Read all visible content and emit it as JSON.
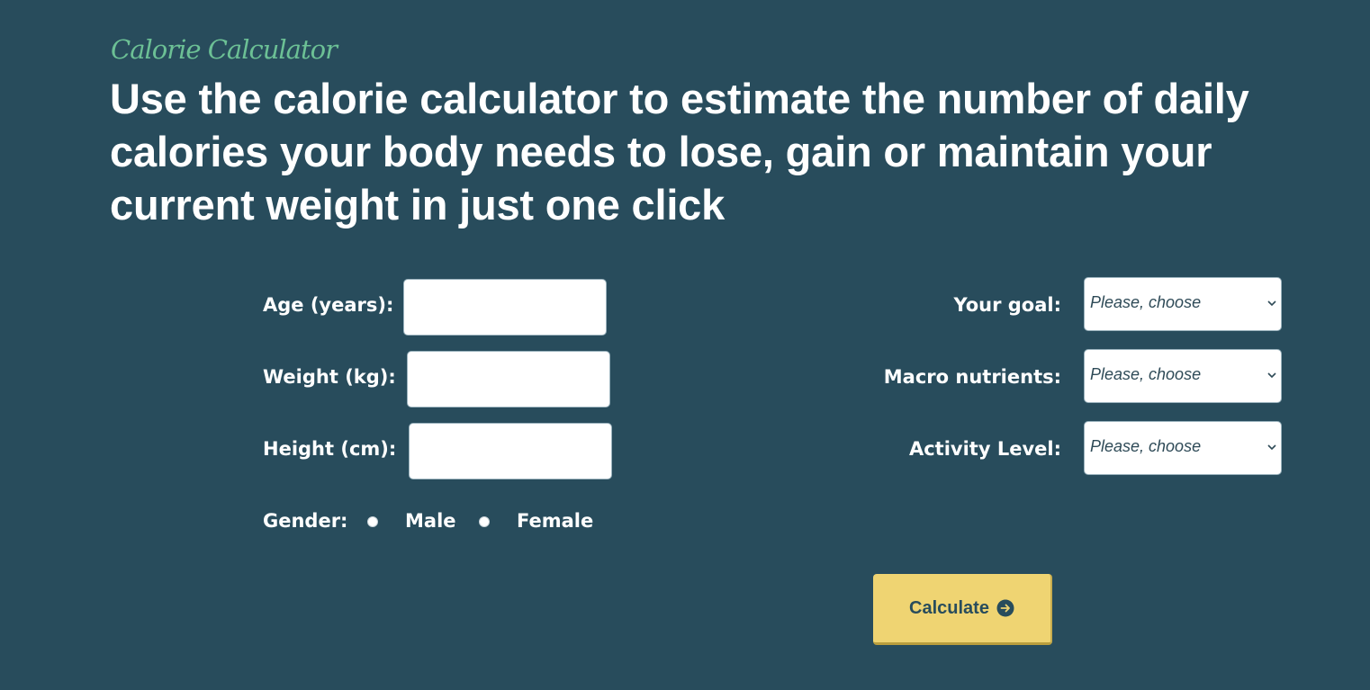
{
  "header": {
    "eyebrow": "Calorie Calculator",
    "headline": "Use the calorie calculator to estimate the number of daily calories your body needs to lose, gain or maintain your current weight in just one click"
  },
  "form": {
    "age_label": "Age (years):",
    "age_value": "",
    "weight_label": "Weight (kg):",
    "weight_value": "",
    "height_label": "Height (cm):",
    "height_value": "",
    "gender_label": "Gender:",
    "gender_options": [
      "Male",
      "Female"
    ],
    "goal_label": "Your goal:",
    "goal_value": "Please, choose",
    "macro_label": "Macro nutrients:",
    "macro_value": "Please, choose",
    "activity_label": "Activity Level:",
    "activity_value": "Please, choose",
    "submit_label": "Calculate",
    "submit_icon": "arrow-right-circle-icon"
  },
  "colors": {
    "background": "#284c5c",
    "eyebrow": "#6cc095",
    "button": "#efd472",
    "button_text": "#284c5c"
  }
}
